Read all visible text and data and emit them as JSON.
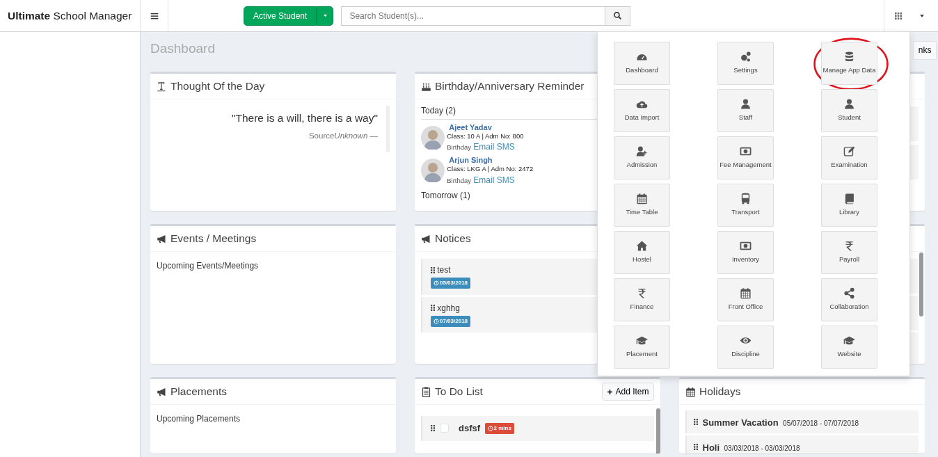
{
  "brand": "**Ultimate** School Manager",
  "student_filter": {
    "label": "Active Student"
  },
  "search": {
    "placeholder": "Search Student(s)..."
  },
  "page_title": "Dashboard",
  "links_button": "nks",
  "thought": {
    "title": "Thought Of the Day",
    "quote": "\"There is a will, there is a way\"",
    "source": "Source",
    "author": "Unknown —"
  },
  "birthdays": {
    "title": "Birthday/Anniversary Reminder",
    "groups": [
      {
        "label": "Today (2)",
        "people": [
          {
            "name": "Ajeet Yadav",
            "details": "Class: 10 A | Adm No: 800",
            "occasion": "Birthday",
            "email": "Email",
            "sms": "SMS"
          },
          {
            "name": "Arjun Singh",
            "details": "Class: LKG A | Adm No: 2472",
            "occasion": "Birthday",
            "email": "Email",
            "sms": "SMS"
          }
        ]
      },
      {
        "label": "Tomorrow (1)"
      }
    ]
  },
  "events": {
    "title": "Events / Meetings",
    "text": "Upcoming Events/Meetings"
  },
  "notices": {
    "title": "Notices",
    "items": [
      {
        "text": "test",
        "date": "05/03/2018"
      },
      {
        "text": "xghhg",
        "date": "07/03/2018"
      }
    ]
  },
  "placements": {
    "title": "Placements",
    "text": "Upcoming Placements"
  },
  "todo": {
    "title": "To Do List",
    "add_button": "Add Item",
    "items": [
      {
        "text": "dsfsf",
        "checked": false,
        "age": "2 mins"
      }
    ]
  },
  "holidays": {
    "title": "Holidays",
    "items": [
      {
        "name": "Summer Vacation",
        "dates": "05/07/2018 - 07/07/2018"
      },
      {
        "name": "Holi",
        "dates": "03/03/2018 - 03/03/2018"
      }
    ]
  },
  "app_menu": {
    "open": true,
    "tiles": [
      {
        "label": "Dashboard",
        "circled": false
      },
      {
        "label": "Settings",
        "circled": false
      },
      {
        "label": "Manage App Data",
        "circled": true
      },
      {
        "label": "Data Import",
        "circled": false
      },
      {
        "label": "Staff",
        "circled": false
      },
      {
        "label": "Student",
        "circled": false
      },
      {
        "label": "Admission",
        "circled": false
      },
      {
        "label": "Fee Management",
        "circled": false
      },
      {
        "label": "Examination",
        "circled": false
      },
      {
        "label": "Time Table",
        "circled": false
      },
      {
        "label": "Transport",
        "circled": false
      },
      {
        "label": "Library",
        "circled": false
      },
      {
        "label": "Hostel",
        "circled": false
      },
      {
        "label": "Inventory",
        "circled": false
      },
      {
        "label": "Payroll",
        "circled": false
      },
      {
        "label": "Finance",
        "circled": false
      },
      {
        "label": "Front Office",
        "circled": false
      },
      {
        "label": "Collaboration",
        "circled": false
      },
      {
        "label": "Placement",
        "circled": false
      },
      {
        "label": "Discipline",
        "circled": false
      },
      {
        "label": "Website",
        "circled": false
      }
    ]
  }
}
